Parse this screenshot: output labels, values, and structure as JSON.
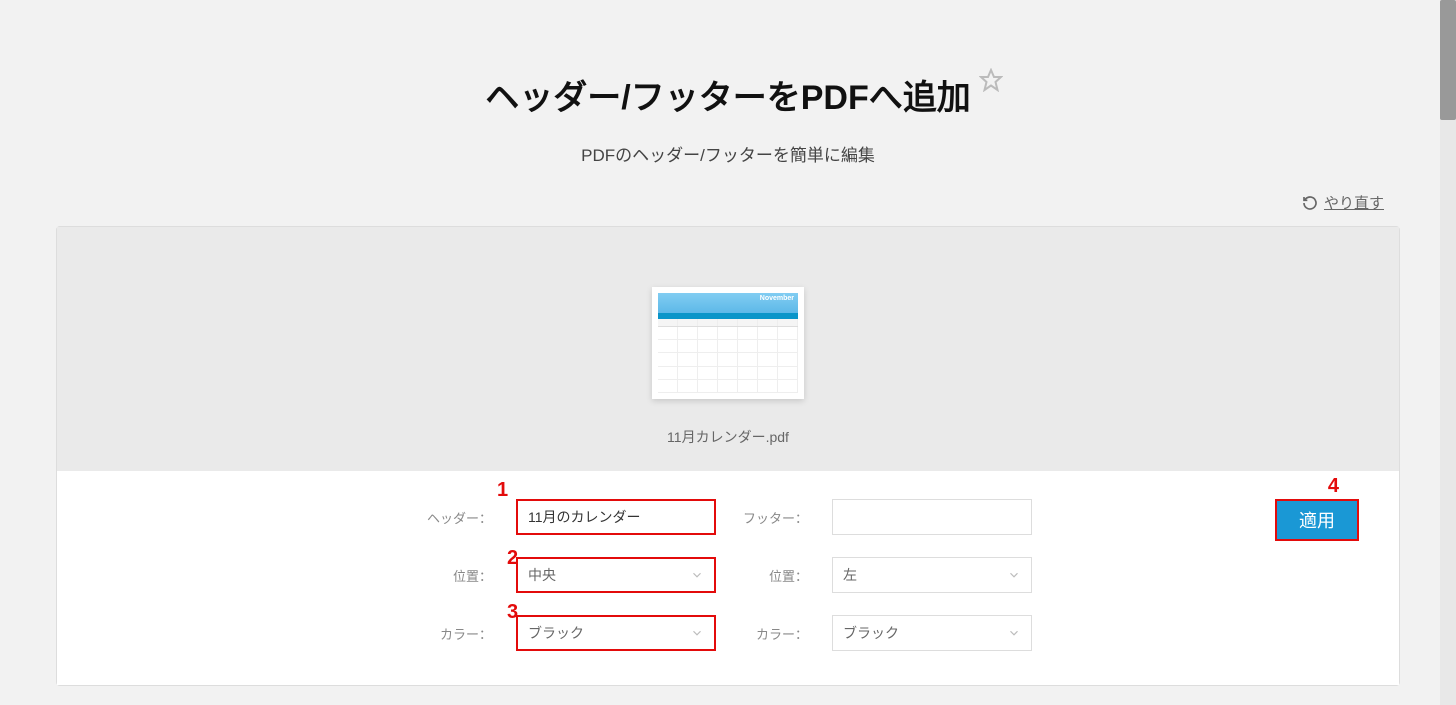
{
  "page": {
    "title": "ヘッダー/フッターをPDFへ追加",
    "subtitle": "PDFのヘッダー/フッターを簡単に編集"
  },
  "redo": {
    "label": "やり直す"
  },
  "file": {
    "name": "11月カレンダー.pdf"
  },
  "form": {
    "header_label": "ヘッダー：",
    "header_value": "11月のカレンダー",
    "footer_label": "フッター：",
    "footer_value": "",
    "position_label_left": "位置：",
    "position_value_left": "中央",
    "position_label_right": "位置：",
    "position_value_right": "左",
    "color_label_left": "カラー：",
    "color_value_left": "ブラック",
    "color_label_right": "カラー：",
    "color_value_right": "ブラック"
  },
  "button": {
    "apply": "適用"
  },
  "annotations": {
    "n1": "1",
    "n2": "2",
    "n3": "3",
    "n4": "4"
  }
}
